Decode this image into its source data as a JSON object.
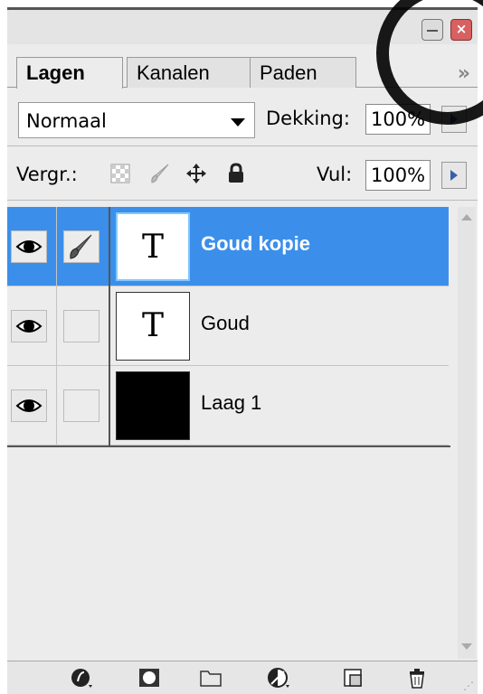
{
  "tabs": [
    {
      "label": "Lagen",
      "active": true
    },
    {
      "label": "Kanalen",
      "active": false
    },
    {
      "label": "Paden",
      "active": false
    }
  ],
  "tab_overflow": "»",
  "blend_mode": {
    "selected": "Normaal"
  },
  "opacity": {
    "label": "Dekking:",
    "value": "100%"
  },
  "lock": {
    "label": "Vergr.:",
    "icons": [
      "lock-transparent-icon",
      "lock-brush-icon",
      "lock-move-icon",
      "lock-all-icon"
    ]
  },
  "fill": {
    "label": "Vul:",
    "value": "100%"
  },
  "layers": [
    {
      "name": "Goud kopie",
      "type": "text",
      "thumb_glyph": "T",
      "selected": true,
      "visible": true,
      "brush": true
    },
    {
      "name": "Goud",
      "type": "text",
      "thumb_glyph": "T",
      "selected": false,
      "visible": true,
      "brush": false
    },
    {
      "name": "Laag 1",
      "type": "fill",
      "thumb_glyph": "",
      "selected": false,
      "visible": true,
      "brush": false
    }
  ],
  "bottom_icons": [
    "link-effects-icon",
    "layer-mask-icon",
    "folder-icon",
    "adjustment-layer-icon",
    "new-layer-icon",
    "trash-icon"
  ],
  "colors": {
    "selection": "#3b8fea",
    "panel": "#ececec"
  }
}
